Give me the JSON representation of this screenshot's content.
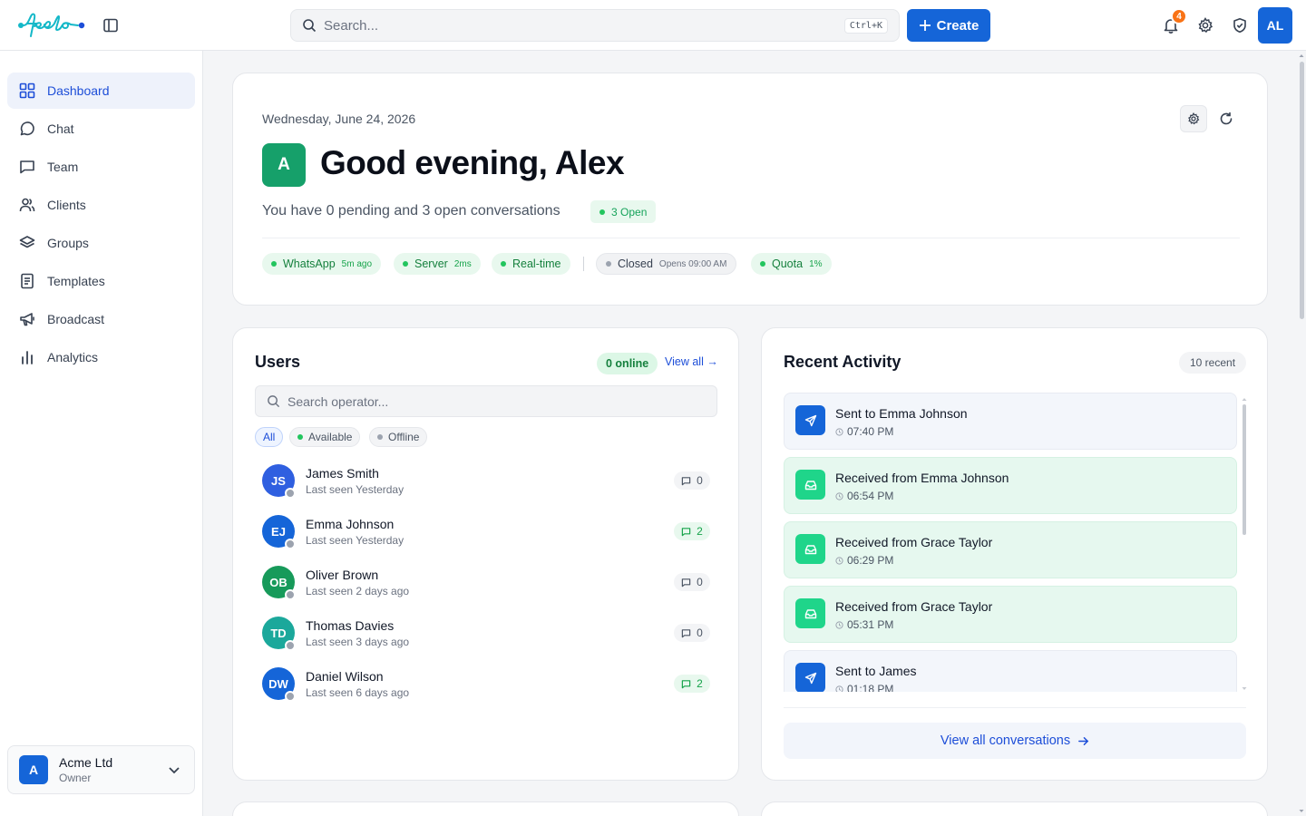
{
  "brand": {
    "name": "feelo",
    "accent": "#1565d8",
    "logo_color": "#14b8c8"
  },
  "topbar": {
    "search_placeholder": "Search...",
    "search_shortcut": "Ctrl+K",
    "create_label": "Create",
    "notification_count": "4",
    "user_initials": "AL"
  },
  "sidebar": {
    "items": [
      {
        "label": "Dashboard",
        "icon": "dashboard-grid-icon",
        "active": true
      },
      {
        "label": "Chat",
        "icon": "chat-bubble-icon"
      },
      {
        "label": "Team",
        "icon": "message-square-icon"
      },
      {
        "label": "Clients",
        "icon": "users-icon"
      },
      {
        "label": "Groups",
        "icon": "layers-icon"
      },
      {
        "label": "Templates",
        "icon": "document-icon"
      },
      {
        "label": "Broadcast",
        "icon": "megaphone-icon"
      },
      {
        "label": "Analytics",
        "icon": "bar-chart-icon"
      }
    ],
    "org": {
      "initial": "A",
      "name": "Acme Ltd",
      "role": "Owner"
    }
  },
  "welcome": {
    "date": "Wednesday, June 24, 2026",
    "avatar_initial": "A",
    "greeting": "Good evening, Alex",
    "summary": "You have 0 pending and 3 open conversations",
    "open_badge": "3 Open",
    "statuses": [
      {
        "label": "WhatsApp",
        "sub": "5m ago",
        "state": "ok"
      },
      {
        "label": "Server",
        "sub": "2ms",
        "state": "ok"
      },
      {
        "label": "Real-time",
        "sub": "",
        "state": "ok"
      },
      {
        "label": "Closed",
        "sub": "Opens 09:00 AM",
        "state": "neutral"
      },
      {
        "label": "Quota",
        "sub": "1%",
        "state": "ok"
      }
    ]
  },
  "users": {
    "title": "Users",
    "online_badge": "0 online",
    "view_all": "View all →",
    "search_placeholder": "Search operator...",
    "filters": [
      "All",
      "Available",
      "Offline"
    ],
    "rows": [
      {
        "initials": "JS",
        "name": "James Smith",
        "seen": "Last seen Yesterday",
        "count": "0",
        "color": "#2f5fe0"
      },
      {
        "initials": "EJ",
        "name": "Emma Johnson",
        "seen": "Last seen Yesterday",
        "count": "2",
        "color": "#1565d8"
      },
      {
        "initials": "OB",
        "name": "Oliver Brown",
        "seen": "Last seen 2 days ago",
        "count": "0",
        "color": "#179a5a"
      },
      {
        "initials": "TD",
        "name": "Thomas Davies",
        "seen": "Last seen 3 days ago",
        "count": "0",
        "color": "#1ba89b"
      },
      {
        "initials": "DW",
        "name": "Daniel Wilson",
        "seen": "Last seen 6 days ago",
        "count": "2",
        "color": "#1565d8"
      }
    ]
  },
  "activity": {
    "title": "Recent Activity",
    "count_badge": "10 recent",
    "items": [
      {
        "type": "sent",
        "title": "Sent to Emma Johnson",
        "time": "07:40 PM"
      },
      {
        "type": "recv",
        "title": "Received from Emma Johnson",
        "time": "06:54 PM"
      },
      {
        "type": "recv",
        "title": "Received from Grace Taylor",
        "time": "06:29 PM"
      },
      {
        "type": "recv",
        "title": "Received from Grace Taylor",
        "time": "05:31 PM"
      },
      {
        "type": "sent",
        "title": "Sent to James",
        "time": "01:18 PM"
      }
    ],
    "view_all": "View all conversations"
  }
}
